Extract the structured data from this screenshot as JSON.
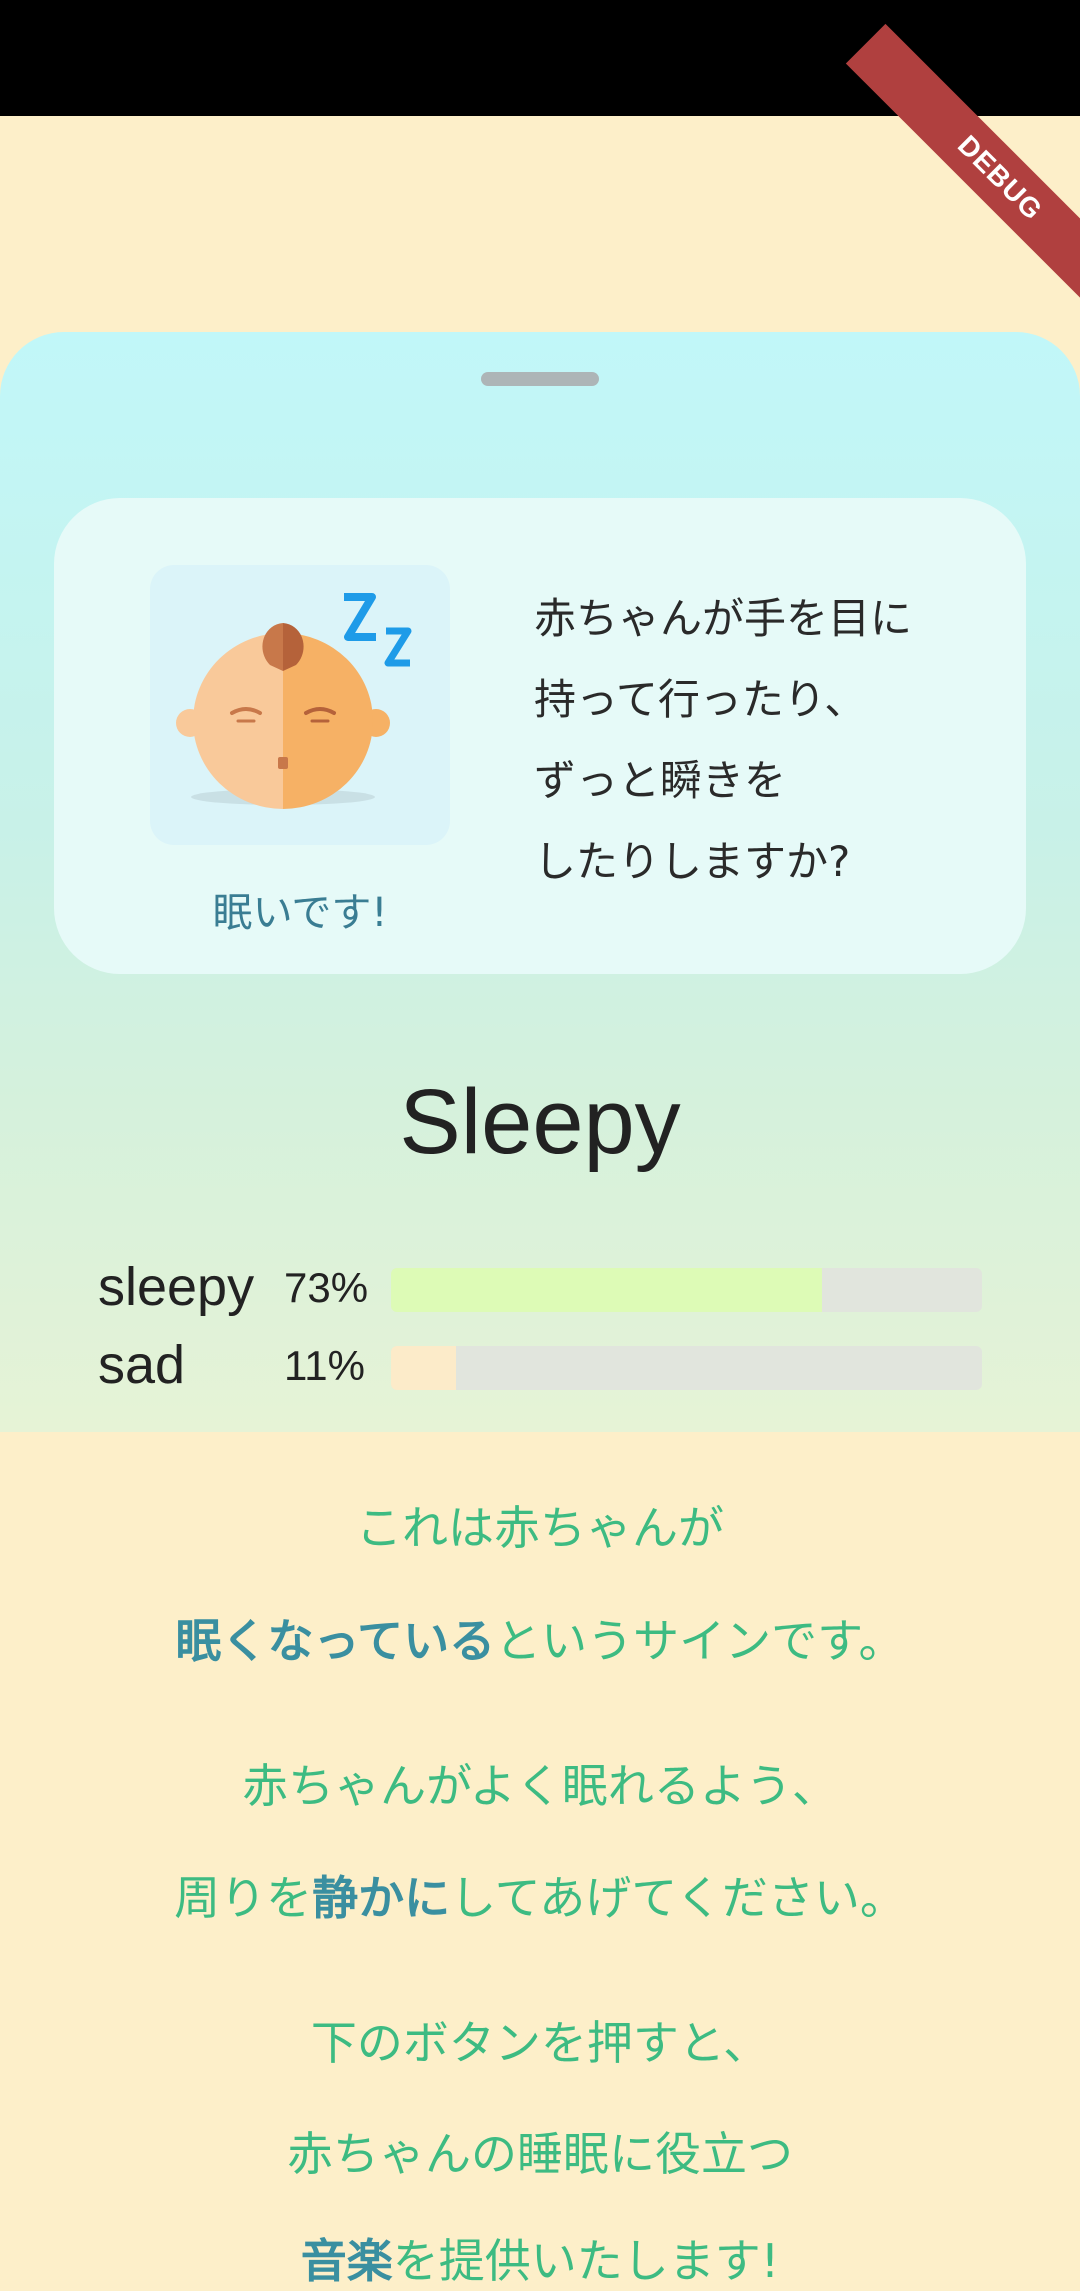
{
  "debug_banner": "DEBUG",
  "card": {
    "emotion_label": "眠いです!",
    "icon": "sleeping-baby-icon",
    "question_lines": [
      "赤ちゃんが手を目に",
      "持って行ったり、",
      "ずっと瞬きを",
      "したりしますか?"
    ]
  },
  "result": {
    "title": "Sleepy",
    "scores": [
      {
        "label": "sleepy",
        "percent_text": "73%",
        "value": 0.73,
        "color": "#DDFBB6"
      },
      {
        "label": "sad",
        "percent_text": "11%",
        "value": 0.11,
        "color": "#FCEBC9"
      }
    ]
  },
  "messages": {
    "line1": "これは赤ちゃんが",
    "line2_em": "眠くなっている",
    "line2_rest": "というサインです。",
    "line3": "赤ちゃんがよく眠れるよう、",
    "line4_pre": "周りを",
    "line4_em": "静かに",
    "line4_rest": "してあげてください。",
    "line5": "下のボタンを押すと、",
    "line6": "赤ちゃんの睡眠に役立つ",
    "line7_em": "音楽",
    "line7_rest": "を提供いたします!"
  },
  "colors": {
    "background": "#FDEFC9",
    "accent_green": "#3DBB82",
    "accent_teal": "#3A8FA0"
  }
}
